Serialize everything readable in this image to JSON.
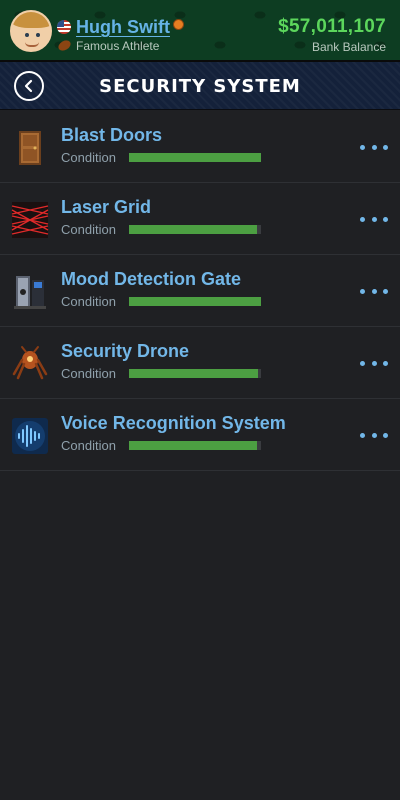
{
  "header": {
    "name": "Hugh Swift",
    "occupation": "Famous Athlete",
    "balance": "$57,011,107",
    "balance_label": "Bank Balance",
    "flag": "us-flag-icon",
    "accent_name": "#66b3e6",
    "accent_money": "#5cd65c"
  },
  "titlebar": {
    "title": "SECURITY SYSTEM",
    "back_icon": "chevron-left-icon"
  },
  "items": [
    {
      "title": "Blast Doors",
      "condition_label": "Condition",
      "condition": 1.0,
      "icon": "door-icon"
    },
    {
      "title": "Laser Grid",
      "condition_label": "Condition",
      "condition": 0.97,
      "icon": "laser-grid-icon"
    },
    {
      "title": "Mood Detection Gate",
      "condition_label": "Condition",
      "condition": 1.0,
      "icon": "gate-icon"
    },
    {
      "title": "Security Drone",
      "condition_label": "Condition",
      "condition": 0.98,
      "icon": "drone-icon"
    },
    {
      "title": "Voice Recognition System",
      "condition_label": "Condition",
      "condition": 0.97,
      "icon": "voice-recognition-icon"
    }
  ]
}
